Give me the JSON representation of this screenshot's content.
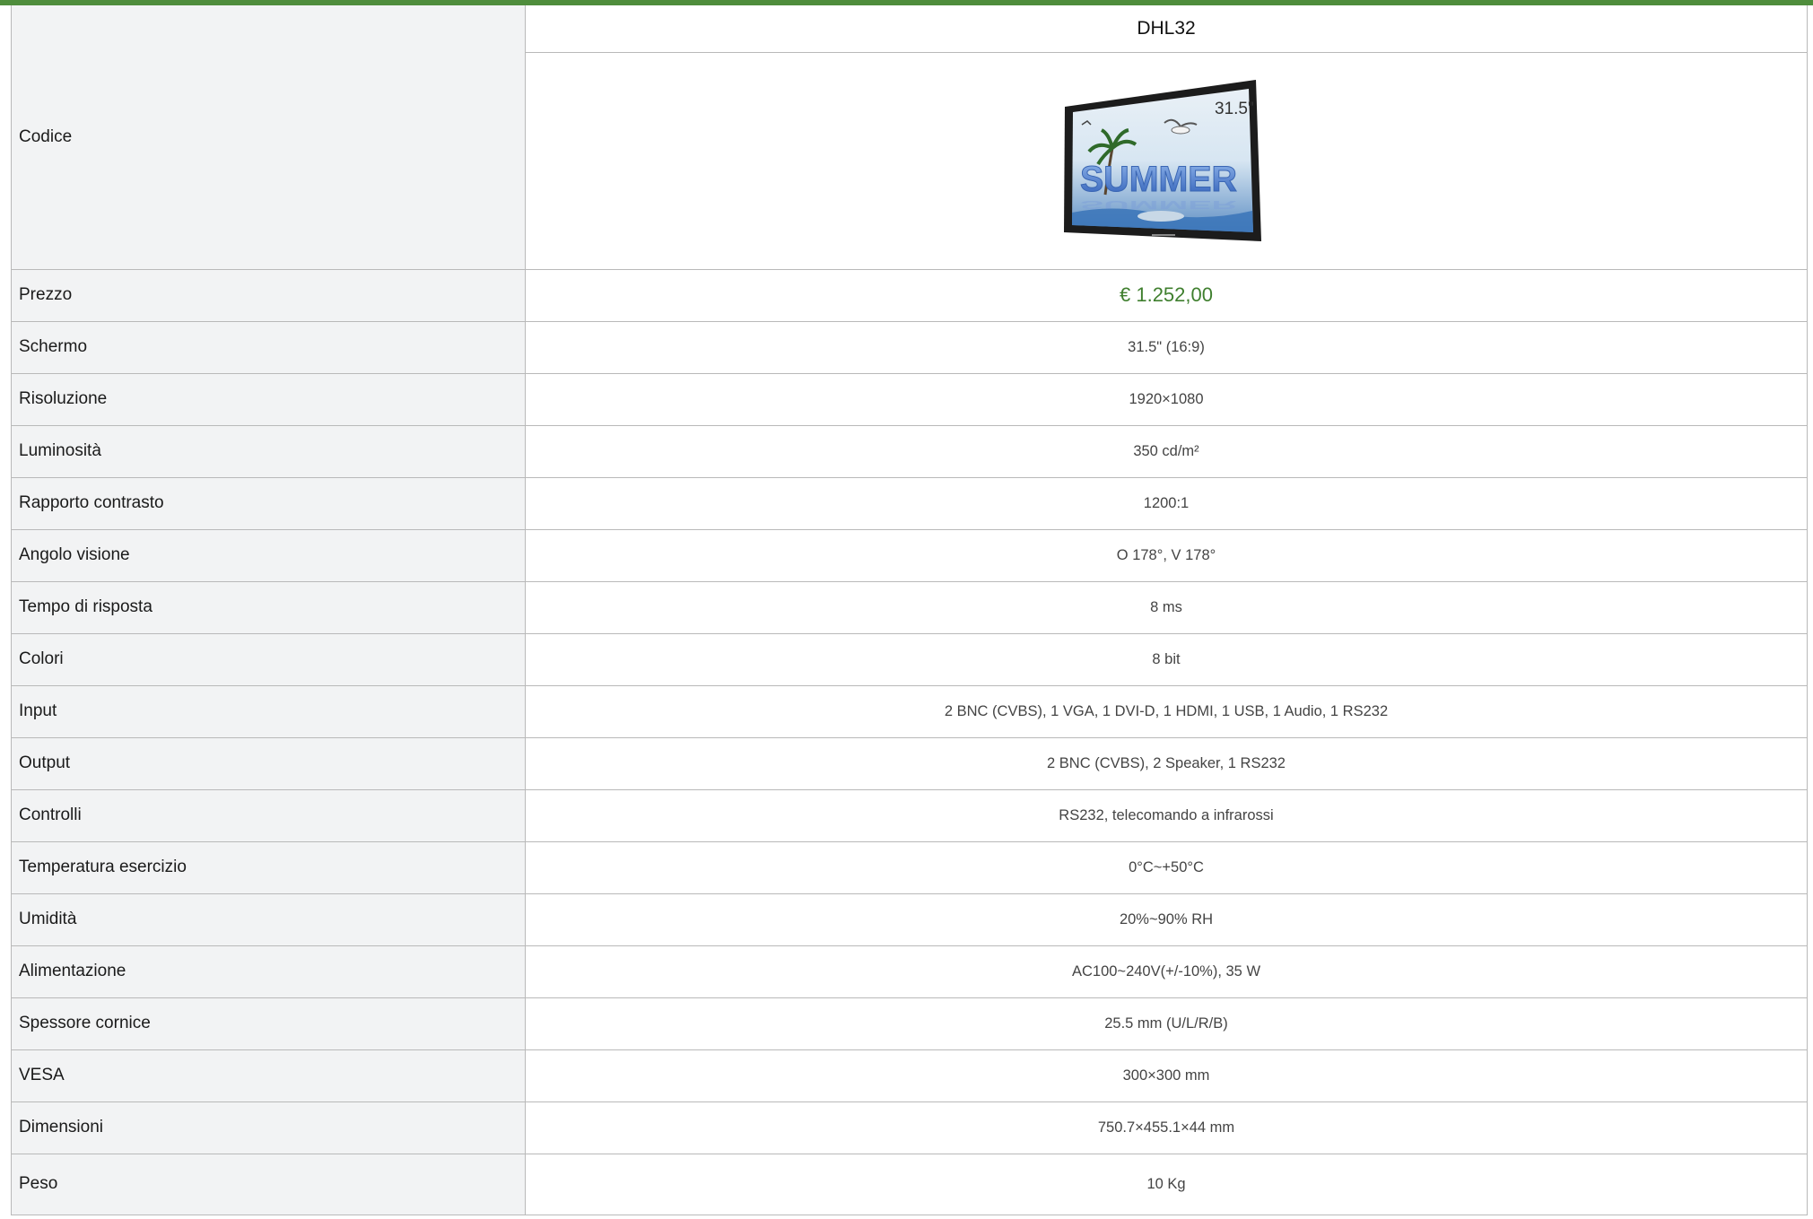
{
  "product": {
    "code_label": "Codice",
    "model": "DHL32",
    "image": {
      "icon": "monitor-product-image",
      "screen_text": "SUMMER",
      "size_badge": "31.5\""
    },
    "price_label": "Prezzo",
    "price": "€ 1.252,00",
    "accent_color": "#4f8d3c",
    "price_color": "#3f7f2e"
  },
  "specs": [
    {
      "label": "Schermo",
      "value": "31.5\" (16:9)"
    },
    {
      "label": "Risoluzione",
      "value": "1920×1080"
    },
    {
      "label": "Luminosità",
      "value": "350 cd/m²"
    },
    {
      "label": "Rapporto contrasto",
      "value": "1200:1"
    },
    {
      "label": "Angolo visione",
      "value": "O 178°, V 178°"
    },
    {
      "label": "Tempo di risposta",
      "value": "8 ms"
    },
    {
      "label": "Colori",
      "value": "8 bit"
    },
    {
      "label": "Input",
      "value": "2 BNC (CVBS), 1 VGA, 1 DVI-D, 1 HDMI, 1 USB, 1 Audio, 1 RS232"
    },
    {
      "label": "Output",
      "value": "2 BNC (CVBS), 2 Speaker, 1 RS232"
    },
    {
      "label": "Controlli",
      "value": "RS232, telecomando a infrarossi"
    },
    {
      "label": "Temperatura esercizio",
      "value": "0°C~+50°C"
    },
    {
      "label": "Umidità",
      "value": "20%~90% RH"
    },
    {
      "label": "Alimentazione",
      "value": "AC100~240V(+/-10%), 35 W"
    },
    {
      "label": "Spessore cornice",
      "value": "25.5 mm (U/L/R/B)"
    },
    {
      "label": "VESA",
      "value": "300×300 mm"
    },
    {
      "label": "Dimensioni",
      "value": "750.7×455.1×44 mm"
    },
    {
      "label": "Peso",
      "value": "10 Kg"
    }
  ]
}
